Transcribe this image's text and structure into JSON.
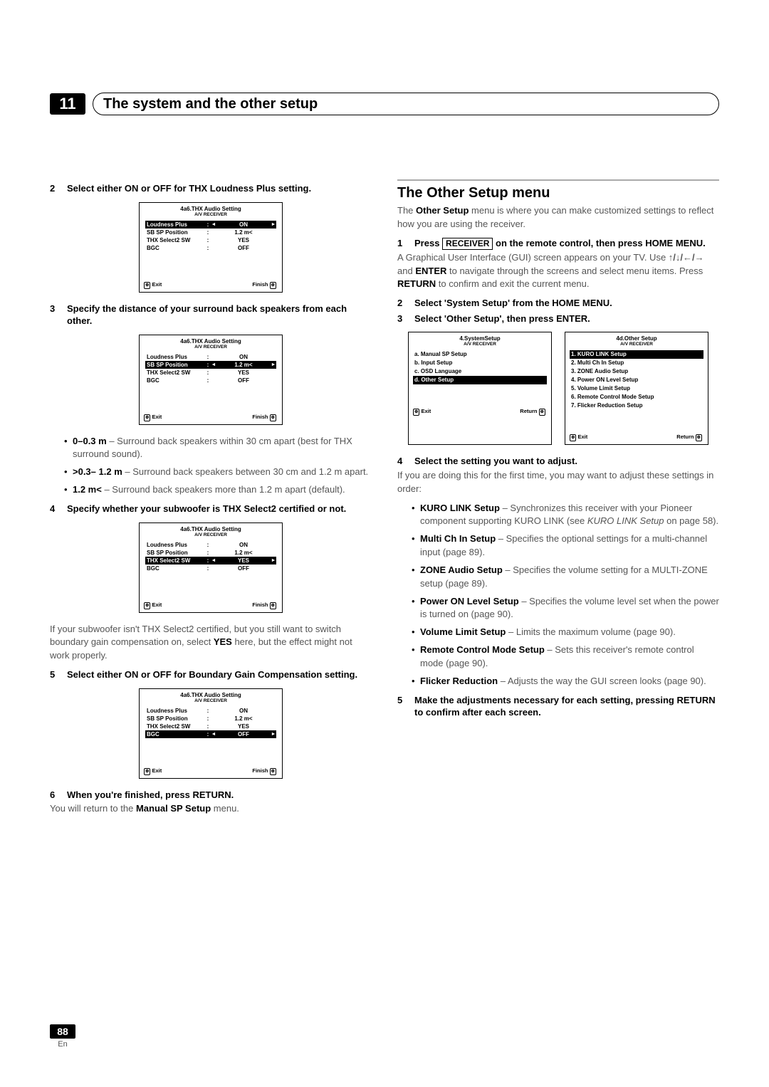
{
  "chapter": {
    "number": "11",
    "title": "The system and the other setup"
  },
  "page": {
    "number": "88",
    "lang": "En"
  },
  "left": {
    "step2": {
      "num": "2",
      "text": "Select either ON or OFF for THX Loudness Plus setting."
    },
    "step3": {
      "num": "3",
      "text": "Specify the distance of your surround back speakers from each other."
    },
    "bullets3": [
      {
        "b": "0–0.3 m",
        "t": " – Surround back speakers within 30 cm apart (best for THX surround sound)."
      },
      {
        "b": ">0.3– 1.2 m",
        "t": " – Surround back speakers between 30 cm and 1.2 m apart."
      },
      {
        "b": "1.2 m<",
        "t": " – Surround back speakers more than 1.2 m apart (default)."
      }
    ],
    "step4": {
      "num": "4",
      "text": "Specify whether your subwoofer is THX Select2 certified or not."
    },
    "para4a": "If your subwoofer isn't THX Select2 certified, but you still want to switch boundary gain compensation on, select ",
    "para4b": "YES",
    "para4c": " here, but the effect might not work properly.",
    "step5": {
      "num": "5",
      "text": "Select either ON or OFF for Boundary Gain Compensation setting."
    },
    "step6": {
      "num": "6",
      "text": "When you're finished, press RETURN."
    },
    "para6a": "You will return to the ",
    "para6b": "Manual SP Setup",
    "para6c": " menu."
  },
  "screens": {
    "title": "4a6.THX Audio Setting",
    "sub": "A/V RECEIVER",
    "rows": [
      {
        "label": "Loudness Plus",
        "val": "ON"
      },
      {
        "label": "SB SP Position",
        "val": "1.2 m<"
      },
      {
        "label": "THX Select2 SW",
        "val": "YES"
      },
      {
        "label": "BGC",
        "val": "OFF"
      }
    ],
    "exit": "Exit",
    "finish": "Finish"
  },
  "right": {
    "heading": "The Other Setup menu",
    "intro_a": "The ",
    "intro_b": "Other Setup",
    "intro_c": " menu is where you can make customized settings to reflect how you are using the receiver.",
    "step1_num": "1",
    "step1_a": "Press ",
    "step1_key": "RECEIVER",
    "step1_b": " on the remote control, then press HOME MENU.",
    "para1_a": "A Graphical User Interface (GUI) screen appears on your TV. Use ",
    "para1_arrows": "↑/↓/←/→",
    "para1_b": " and ",
    "para1_enter": "ENTER",
    "para1_c": " to navigate through the screens and select menu items. Press ",
    "para1_return": "RETURN",
    "para1_d": " to confirm and exit the current menu.",
    "step2": {
      "num": "2",
      "text": "Select 'System Setup' from the HOME MENU."
    },
    "step3": {
      "num": "3",
      "text": "Select 'Other Setup', then press ENTER."
    },
    "menu_left": {
      "title": "4.SystemSetup",
      "items": [
        "a. Manual SP Setup",
        "b. Input Setup",
        "c. OSD Language",
        "d. Other Setup"
      ],
      "hl_index": 3,
      "exit": "Exit",
      "ret": "Return"
    },
    "menu_right": {
      "title": "4d.Other Setup",
      "items": [
        "1. KURO LINK Setup",
        "2. Multi Ch In Setup",
        "3. ZONE Audio Setup",
        "4. Power ON Level Setup",
        "5. Volume Limit Setup",
        "6. Remote Control Mode Setup",
        "7. Flicker Reduction Setup"
      ],
      "hl_index": 0,
      "exit": "Exit",
      "ret": "Return"
    },
    "step4": {
      "num": "4",
      "text": "Select the setting you want to adjust."
    },
    "para4": "If you are doing this for the first time, you may want to adjust these settings in order:",
    "bullets": [
      {
        "b": "KURO LINK Setup",
        "t": " – Synchronizes this receiver with your Pioneer component supporting KURO LINK (see ",
        "it": "KURO LINK Setup",
        "tail": " on page 58)."
      },
      {
        "b": "Multi Ch In Setup",
        "t": " – Specifies the optional settings for a multi-channel input (page 89).",
        "it": "",
        "tail": ""
      },
      {
        "b": "ZONE Audio Setup",
        "t": " – Specifies the volume setting for a MULTI-ZONE setup (page 89).",
        "it": "",
        "tail": ""
      },
      {
        "b": "Power ON Level Setup",
        "t": " – Specifies the volume level set when the power is turned on (page 90).",
        "it": "",
        "tail": ""
      },
      {
        "b": "Volume Limit Setup",
        "t": " – Limits the maximum volume (page 90).",
        "it": "",
        "tail": ""
      },
      {
        "b": "Remote Control Mode Setup",
        "t": " – Sets this receiver's remote control mode (page 90).",
        "it": "",
        "tail": ""
      },
      {
        "b": "Flicker Reduction",
        "t": " – Adjusts the way the GUI screen looks (page 90).",
        "it": "",
        "tail": ""
      }
    ],
    "step5": {
      "num": "5",
      "text": "Make the adjustments necessary for each setting, pressing RETURN to confirm after each screen."
    }
  }
}
